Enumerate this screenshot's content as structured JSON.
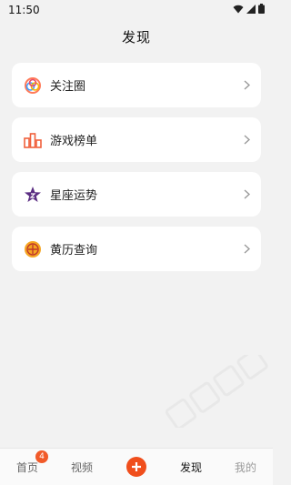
{
  "status": {
    "time": "11:50"
  },
  "header": {
    "title": "发现"
  },
  "menu": [
    {
      "label": "关注圈",
      "icon": "circles-icon"
    },
    {
      "label": "游戏榜单",
      "icon": "ranking-icon"
    },
    {
      "label": "星座运势",
      "icon": "star-icon"
    },
    {
      "label": "黄历查询",
      "icon": "almanac-icon"
    }
  ],
  "tabs": {
    "home": "首页",
    "home_badge": "4",
    "video": "视频",
    "discover": "发现",
    "mine": "我的"
  }
}
